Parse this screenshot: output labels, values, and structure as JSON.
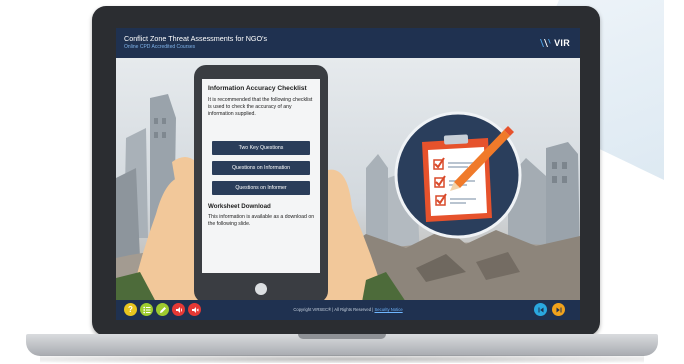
{
  "header": {
    "title": "Conflict Zone Threat Assessments for NGO's",
    "subtitle": "Online CPD Accredited Courses",
    "logo_text": "VIR",
    "logo_icon": "virsec-logo"
  },
  "phone": {
    "heading": "Information Accuracy Checklist",
    "intro": "It is recommended that the following checklist is used to check the accuracy of any information supplied.",
    "buttons": [
      "Two Key Questions",
      "Questions on Information",
      "Questions on Informer"
    ],
    "worksheet_heading": "Worksheet Download",
    "worksheet_text": "This information is available as a download on the following slide."
  },
  "footer": {
    "copyright": "Copyright VIRSEC® | All Rights Reserved |",
    "link": "Security Notice",
    "controls": [
      {
        "icon": "help-icon",
        "glyph": "?",
        "color": "#e8c51f"
      },
      {
        "icon": "menu-list-icon",
        "glyph": "",
        "color": "#9ecb2f"
      },
      {
        "icon": "pencil-icon",
        "glyph": "",
        "color": "#9ecb2f"
      },
      {
        "icon": "audio-icon",
        "glyph": "",
        "color": "#e53935"
      },
      {
        "icon": "mute-icon",
        "glyph": "",
        "color": "#e53935"
      }
    ],
    "prev_icon": "previous-icon",
    "next_icon": "next-icon",
    "prev_color": "#2aa8e0",
    "next_color": "#f0a21c"
  }
}
